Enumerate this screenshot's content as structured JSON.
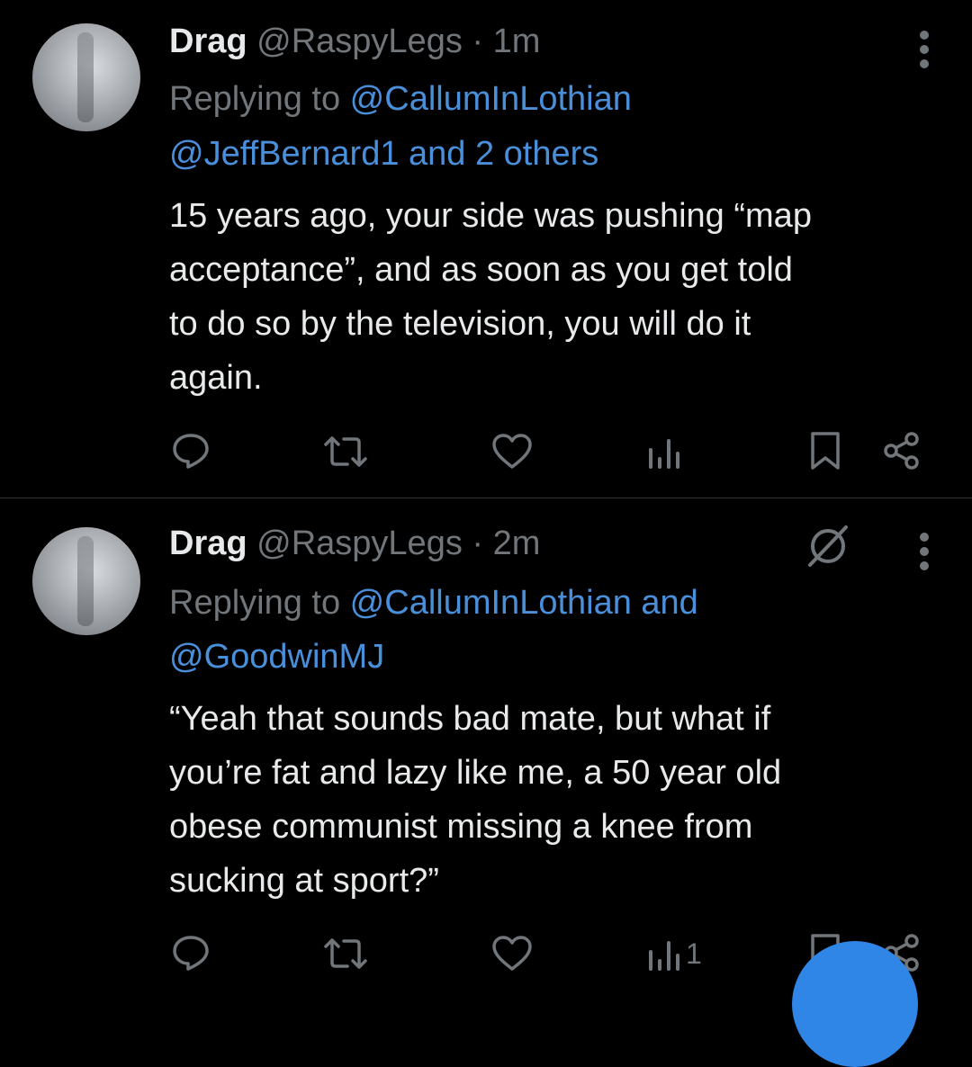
{
  "tweets": [
    {
      "display_name": "Drag",
      "handle": "@RaspyLegs",
      "separator": "·",
      "time": "1m",
      "replying_prefix": "Replying to ",
      "reply_user_1": "@CallumInLothian",
      "reply_line_2": "@JeffBernard1 and 2 others",
      "body_lines": [
        "15 years ago, your side was pushing “map",
        "acceptance”, and as soon as you get told",
        "to do so by the television, you will do it",
        "again."
      ],
      "icons": [
        "reply-icon",
        "retweet-icon",
        "like-icon",
        "views-icon",
        "bookmark-icon",
        "share-icon"
      ]
    },
    {
      "display_name": "Drag",
      "handle": "@RaspyLegs",
      "separator": "·",
      "time": "2m",
      "replying_prefix": "Replying to ",
      "reply_user_1": "@CallumInLothian and",
      "reply_line_2": "@GoodwinMJ",
      "body_lines": [
        "“Yeah that sounds bad mate, but what if",
        "you’re fat and lazy like me, a 50 year old",
        "obese communist missing a knee from",
        "sucking at sport?”"
      ],
      "views_count": "1",
      "icons": [
        "reply-icon",
        "retweet-icon",
        "like-icon",
        "views-icon",
        "bookmark-icon",
        "share-icon",
        "grok-icon"
      ]
    }
  ],
  "colors": {
    "background": "#000000",
    "text": "#e7e9ea",
    "muted": "#71767b",
    "link": "#4a8fd9",
    "fab": "#2f86e6"
  }
}
